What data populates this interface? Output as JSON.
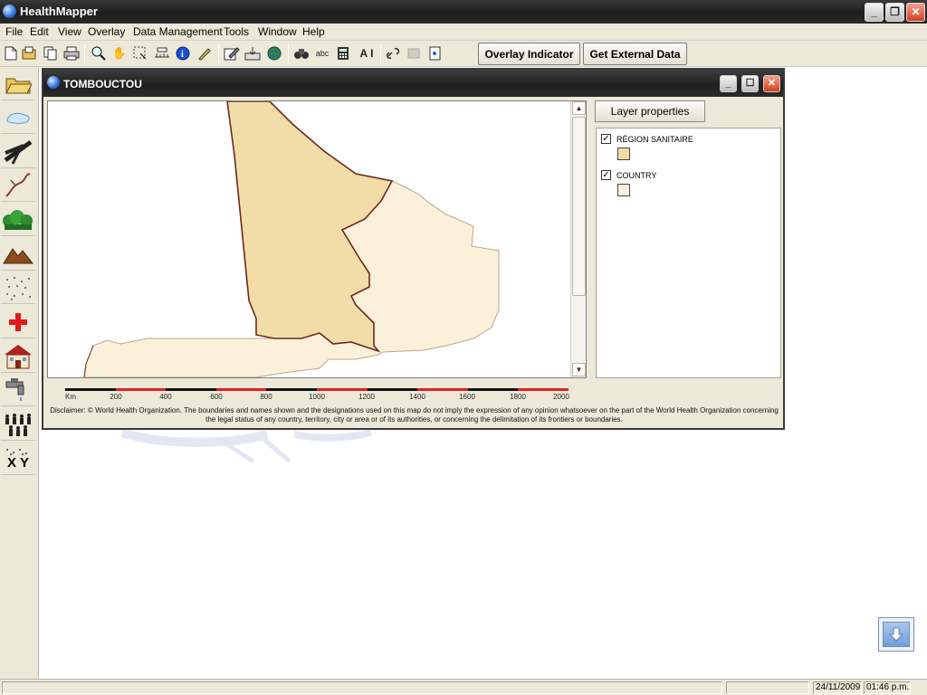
{
  "app": {
    "title": "HealthMapper",
    "icon": "globe-icon"
  },
  "menu": [
    "File",
    "Edit",
    "View",
    "Overlay",
    "Data Management",
    "Tools",
    "Window",
    "Help"
  ],
  "toolbar": {
    "icons": [
      "new-icon",
      "open-icon",
      "copy-icon",
      "print-icon",
      "zoom-icon",
      "pan-hand-icon",
      "select-icon",
      "measure-icon",
      "info-icon",
      "pencil-icon",
      "edit-icon",
      "import-icon",
      "globe-icon",
      "binoculars-icon",
      "label-icon",
      "calculator-icon",
      "text-icon",
      "link-icon",
      "disabled-icon",
      "page-icon"
    ],
    "label_abc": "abc",
    "label_ai": "A I",
    "overlay_indicator": "Overlay Indicator",
    "get_external_data": "Get External Data"
  },
  "left_tools": [
    "open-folder-icon",
    "lake-icon",
    "road-icon",
    "river-icon",
    "forest-icon",
    "mountain-icon",
    "dots-icon",
    "health-cross-icon",
    "school-house-icon",
    "water-tap-icon",
    "population-icon",
    "xy-coordinates-icon"
  ],
  "left_tools_xy_label": "X Y",
  "map_window": {
    "title": "TOMBOUCTOU",
    "layer_properties": "Layer properties",
    "layers": [
      {
        "name": "RÉGION SANITAIRE",
        "checked": true,
        "color": "#f2dca8"
      },
      {
        "name": "COUNTRY",
        "checked": true,
        "color": "#fbf0d9"
      }
    ],
    "scale_labels": [
      "Km",
      "200",
      "400",
      "600",
      "800",
      "1000",
      "1200",
      "1400",
      "1600",
      "1800",
      "2000"
    ],
    "disclaimer": "Disclaimer: © World Health Organization. The boundaries and names shown and the designations used on this map do not imply the expression of any opinion whatsoever on the part of the World Health Organization concerning the legal status of any country, territory, city or area or of its authorities, or concerning the delimitation of its frontiers or boundaries."
  },
  "status": {
    "date": "24/11/2009",
    "time": "01:46 p.m."
  },
  "colors": {
    "region_fill": "#f2dca8",
    "country_fill": "#fbf0d9",
    "region_border": "#6b2a1c",
    "scale_red": "#e02020",
    "scale_black": "#111111"
  }
}
